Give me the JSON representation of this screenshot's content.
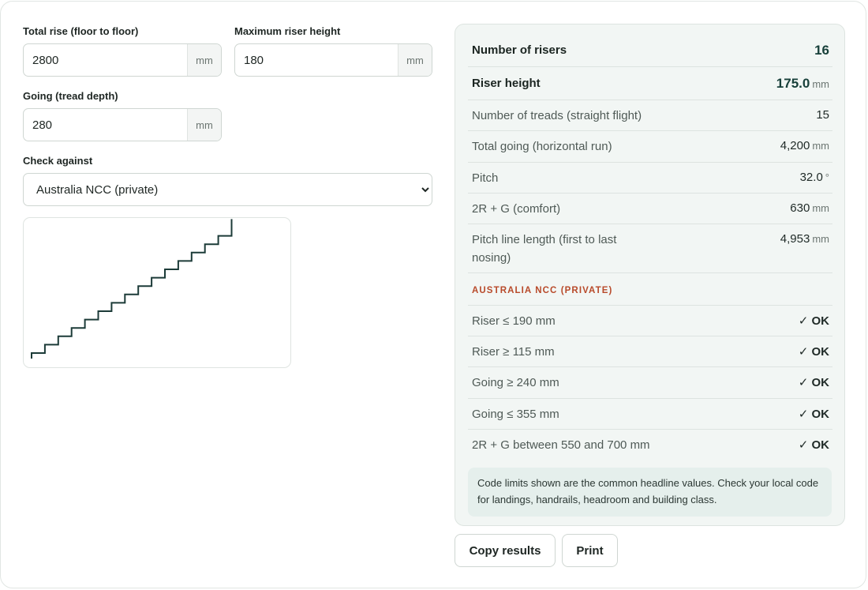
{
  "inputs": {
    "total_rise": {
      "label": "Total rise (floor to floor)",
      "value": "2800",
      "unit": "mm"
    },
    "max_riser": {
      "label": "Maximum riser height",
      "value": "180",
      "unit": "mm"
    },
    "going": {
      "label": "Going (tread depth)",
      "value": "280",
      "unit": "mm"
    },
    "check_against": {
      "label": "Check against",
      "selected": "Australia NCC (private)"
    }
  },
  "diagram": {
    "steps": 16,
    "riser_mm": 175.0,
    "going_mm": 280
  },
  "results": {
    "rows": [
      {
        "label": "Number of risers",
        "value": "16",
        "unit": ""
      },
      {
        "label": "Riser height",
        "value": "175.0",
        "unit": "mm"
      },
      {
        "label": "Number of treads (straight flight)",
        "value": "15",
        "unit": ""
      },
      {
        "label": "Total going (horizontal run)",
        "value": "4,200",
        "unit": "mm"
      },
      {
        "label": "Pitch",
        "value": "32.0",
        "unit": "°"
      },
      {
        "label": "2R + G (comfort)",
        "value": "630",
        "unit": "mm"
      },
      {
        "label": "Pitch line length (first to last nosing)",
        "value": "4,953",
        "unit": "mm"
      }
    ],
    "code_title": "AUSTRALIA NCC (PRIVATE)",
    "checks": [
      {
        "label": "Riser ≤ 190 mm",
        "status": "✓ OK"
      },
      {
        "label": "Riser ≥ 115 mm",
        "status": "✓ OK"
      },
      {
        "label": "Going ≥ 240 mm",
        "status": "✓ OK"
      },
      {
        "label": "Going ≤ 355 mm",
        "status": "✓ OK"
      },
      {
        "label": "2R + G between 550 and 700 mm",
        "status": "✓ OK"
      }
    ],
    "note": "Code limits shown are the common headline values. Check your local code for landings, handrails, headroom and building class."
  },
  "actions": {
    "copy": "Copy results",
    "print": "Print"
  },
  "colors": {
    "accent": "#18403a",
    "stair_line": "#1c3b38",
    "ok": "#2f6f4a",
    "code_title": "#b84a2a"
  }
}
